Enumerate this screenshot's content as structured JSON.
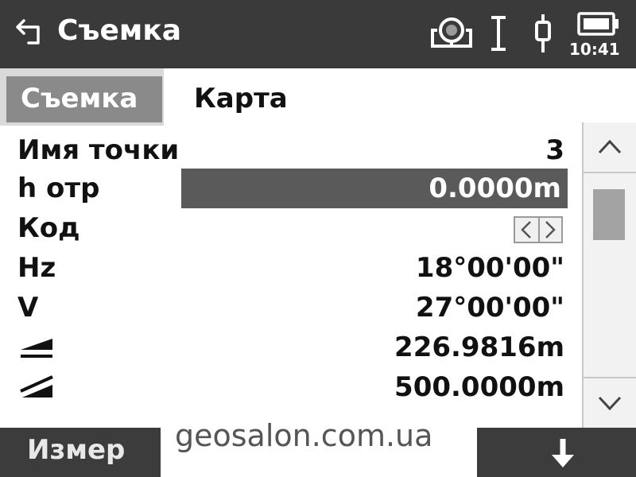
{
  "header": {
    "title": "Съемка",
    "time": "10:41",
    "icons": [
      "back-arrow-icon",
      "prism-target-icon",
      "laser-icon",
      "prism-pole-icon",
      "battery-icon"
    ]
  },
  "tabs": {
    "active": "Съемка",
    "inactive": "Карта"
  },
  "fields": {
    "point_name": {
      "label": "Имя точки",
      "value": "3"
    },
    "target_height": {
      "label": "h отр",
      "value": "0.0000m"
    },
    "code": {
      "label": "Код"
    },
    "hz": {
      "label": "Hz",
      "value": "18°00'00\""
    },
    "v": {
      "label": "V",
      "value": "27°00'00\""
    },
    "horizontal_distance": {
      "icon": "horizontal-distance-icon",
      "value": "226.9816m"
    },
    "slope_distance": {
      "icon": "slope-distance-icon",
      "value": "500.0000m"
    }
  },
  "softkeys": {
    "measure": "Измер",
    "page_down_icon": "arrow-down-icon"
  },
  "watermark": "geosalon.com.ua",
  "colors": {
    "titlebar": "#3a3a3a",
    "active_tab": "#8a8a8a",
    "input_highlight": "#5a5a5a",
    "softkey_bar": "#3c3c3c"
  }
}
